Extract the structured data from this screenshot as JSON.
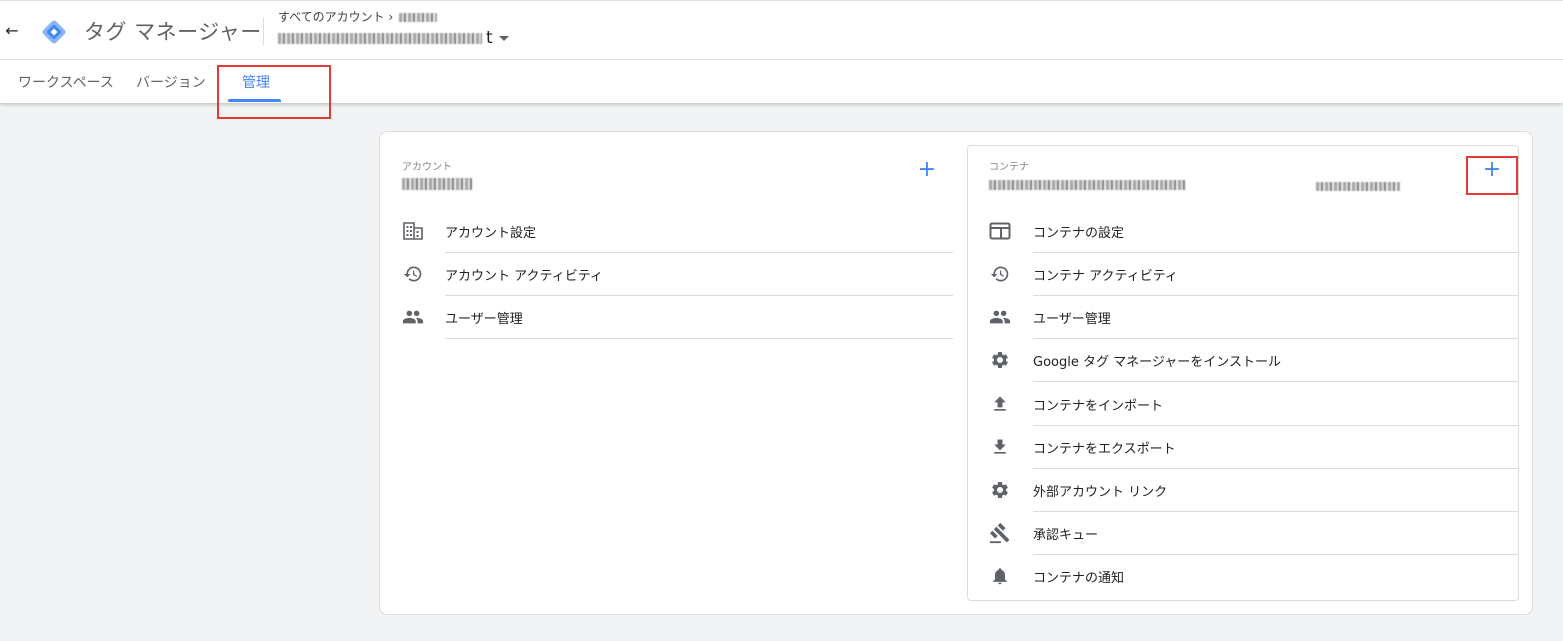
{
  "header": {
    "back_icon": "arrow-left-icon",
    "logo_icon": "tag-manager-diamond-icon",
    "app_title": "タグ マネージャー",
    "account_crumb": "すべてのアカウント ›",
    "container_suffix": "t",
    "dropdown_icon": "caret-down-icon"
  },
  "tabs": [
    {
      "label": "ワークスペース",
      "active": false
    },
    {
      "label": "バージョン",
      "active": false
    },
    {
      "label": "管理",
      "active": true
    }
  ],
  "colors": {
    "accent": "#4285f4",
    "highlight_box": "#e53935",
    "background": "#f1f3f4"
  },
  "account_panel": {
    "label": "アカウント",
    "add_icon": "plus-icon",
    "items": [
      {
        "label": "アカウント設定",
        "icon": "building-icon"
      },
      {
        "label": "アカウント アクティビティ",
        "icon": "history-icon"
      },
      {
        "label": "ユーザー管理",
        "icon": "people-icon"
      }
    ]
  },
  "container_panel": {
    "label": "コンテナ",
    "add_icon": "plus-icon",
    "items": [
      {
        "label": "コンテナの設定",
        "icon": "web-window-icon"
      },
      {
        "label": "コンテナ アクティビティ",
        "icon": "history-icon"
      },
      {
        "label": "ユーザー管理",
        "icon": "people-icon"
      },
      {
        "label": "Google タグ マネージャーをインストール",
        "icon": "gear-icon"
      },
      {
        "label": "コンテナをインポート",
        "icon": "upload-icon"
      },
      {
        "label": "コンテナをエクスポート",
        "icon": "download-icon"
      },
      {
        "label": "外部アカウント リンク",
        "icon": "gear-icon"
      },
      {
        "label": "承認キュー",
        "icon": "gavel-icon"
      },
      {
        "label": "コンテナの通知",
        "icon": "bell-icon"
      }
    ]
  }
}
